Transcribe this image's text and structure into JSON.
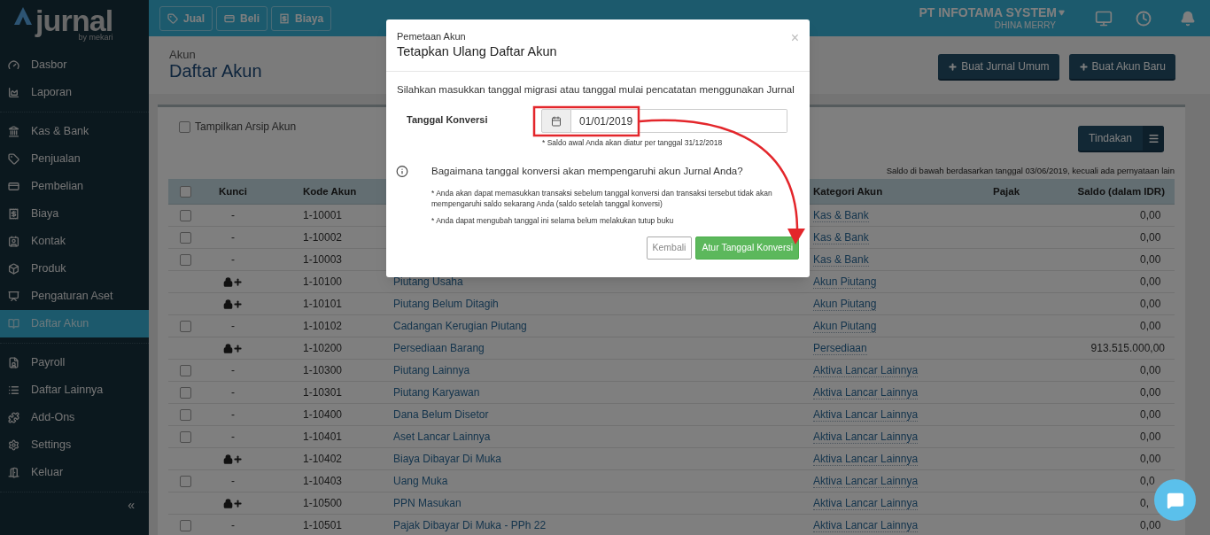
{
  "logo": {
    "word": "jurnal",
    "tagline": "by mekari"
  },
  "sidebar": {
    "sections": [
      {
        "items": [
          {
            "label": "Dasbor",
            "selected": false
          },
          {
            "label": "Laporan",
            "selected": false
          }
        ]
      },
      {
        "items": [
          {
            "label": "Kas & Bank",
            "selected": false
          },
          {
            "label": "Penjualan",
            "selected": false
          },
          {
            "label": "Pembelian",
            "selected": false
          },
          {
            "label": "Biaya",
            "selected": false
          },
          {
            "label": "Kontak",
            "selected": false
          },
          {
            "label": "Produk",
            "selected": false
          },
          {
            "label": "Pengaturan Aset",
            "selected": false
          },
          {
            "label": "Daftar Akun",
            "selected": true
          }
        ]
      },
      {
        "items": [
          {
            "label": "Payroll",
            "selected": false
          },
          {
            "label": "Daftar Lainnya",
            "selected": false
          },
          {
            "label": "Add-Ons",
            "selected": false
          },
          {
            "label": "Settings",
            "selected": false
          },
          {
            "label": "Keluar",
            "selected": false
          }
        ]
      }
    ],
    "collapse": "«"
  },
  "topbar": {
    "buttons": [
      "Jual",
      "Beli",
      "Biaya"
    ],
    "company": "PT INFOTAMA SYSTEM",
    "user": "DHINA MERRY"
  },
  "page": {
    "breadcrumb": "Akun",
    "title": "Daftar Akun",
    "actions": [
      "Buat Jurnal Umum",
      "Buat Akun Baru"
    ]
  },
  "archive_toggle": {
    "label": "Tampilkan Arsip Akun",
    "checked": false
  },
  "actions_button": "Tindakan",
  "balance_note": "Saldo di bawah berdasarkan tanggal 03/06/2019, kecuali ada pernyataan lain",
  "table": {
    "select_all": {
      "checked": false
    },
    "columns": [
      "Kunci",
      "Kode Akun",
      "Kategori Akun",
      "Pajak",
      "Saldo (dalam IDR)"
    ],
    "rows": [
      {
        "locked": false,
        "checked": false,
        "kunci": "-",
        "code": "1-10001",
        "category": "Kas & Bank",
        "balance": "0,00"
      },
      {
        "locked": false,
        "checked": false,
        "kunci": "-",
        "code": "1-10002",
        "category": "Kas & Bank",
        "balance": "0,00"
      },
      {
        "locked": false,
        "checked": false,
        "kunci": "-",
        "code": "1-10003",
        "category": "Kas & Bank",
        "balance": "0,00"
      },
      {
        "locked": true,
        "code": "1-10100",
        "name": "Piutang Usaha",
        "category": "Akun Piutang",
        "balance": "0,00"
      },
      {
        "locked": true,
        "code": "1-10101",
        "name": "Piutang Belum Ditagih",
        "category": "Akun Piutang",
        "balance": "0,00"
      },
      {
        "locked": false,
        "checked": false,
        "kunci": "-",
        "code": "1-10102",
        "name": "Cadangan Kerugian Piutang",
        "category": "Akun Piutang",
        "balance": "0,00"
      },
      {
        "locked": true,
        "code": "1-10200",
        "name": "Persediaan Barang",
        "category": "Persediaan",
        "balance": "913.515.000,00"
      },
      {
        "locked": false,
        "checked": false,
        "kunci": "-",
        "code": "1-10300",
        "name": "Piutang Lainnya",
        "category": "Aktiva Lancar Lainnya",
        "balance": "0,00"
      },
      {
        "locked": false,
        "checked": false,
        "kunci": "-",
        "code": "1-10301",
        "name": "Piutang Karyawan",
        "category": "Aktiva Lancar Lainnya",
        "balance": "0,00"
      },
      {
        "locked": false,
        "checked": false,
        "kunci": "-",
        "code": "1-10400",
        "name": "Dana Belum Disetor",
        "category": "Aktiva Lancar Lainnya",
        "balance": "0,00"
      },
      {
        "locked": false,
        "checked": false,
        "kunci": "-",
        "code": "1-10401",
        "name": "Aset Lancar Lainnya",
        "category": "Aktiva Lancar Lainnya",
        "balance": "0,00"
      },
      {
        "locked": true,
        "code": "1-10402",
        "name": "Biaya Dibayar Di Muka",
        "category": "Aktiva Lancar Lainnya",
        "balance": "0,00"
      },
      {
        "locked": false,
        "checked": false,
        "kunci": "-",
        "code": "1-10403",
        "name": "Uang Muka",
        "category": "Aktiva Lancar Lainnya",
        "balance": "0,0"
      },
      {
        "locked": true,
        "code": "1-10500",
        "name": "PPN Masukan",
        "category": "Aktiva Lancar Lainnya",
        "balance": "0,"
      },
      {
        "locked": false,
        "checked": false,
        "kunci": "-",
        "code": "1-10501",
        "name": "Pajak Dibayar Di Muka - PPh 22",
        "category": "Aktiva Lancar Lainnya",
        "balance": "0,00"
      }
    ]
  },
  "modal": {
    "subtitle": "Pemetaan Akun",
    "title": "Tetapkan Ulang Daftar Akun",
    "close": "×",
    "intro": "Silahkan masukkan tanggal migrasi atau tanggal mulai pencatatan menggunakan Jurnal",
    "field_label": "Tanggal Konversi",
    "date": "01/01/2019",
    "field_note": "* Saldo awal Anda akan diatur per tanggal 31/12/2018",
    "question": "Bagaimana tanggal konversi akan mempengaruhi akun Jurnal Anda?",
    "notes": [
      "* Anda akan dapat memasukkan transaksi sebelum tanggal konversi dan transaksi tersebut tidak akan mempengaruhi saldo sekarang Anda (saldo setelah tanggal konversi)",
      "* Anda dapat mengubah tanggal ini selama belum melakukan tutup buku"
    ],
    "buttons": [
      {
        "label": "Kembali",
        "kind": "secondary"
      },
      {
        "label": "Atur Tanggal Konversi",
        "kind": "primary"
      }
    ]
  }
}
